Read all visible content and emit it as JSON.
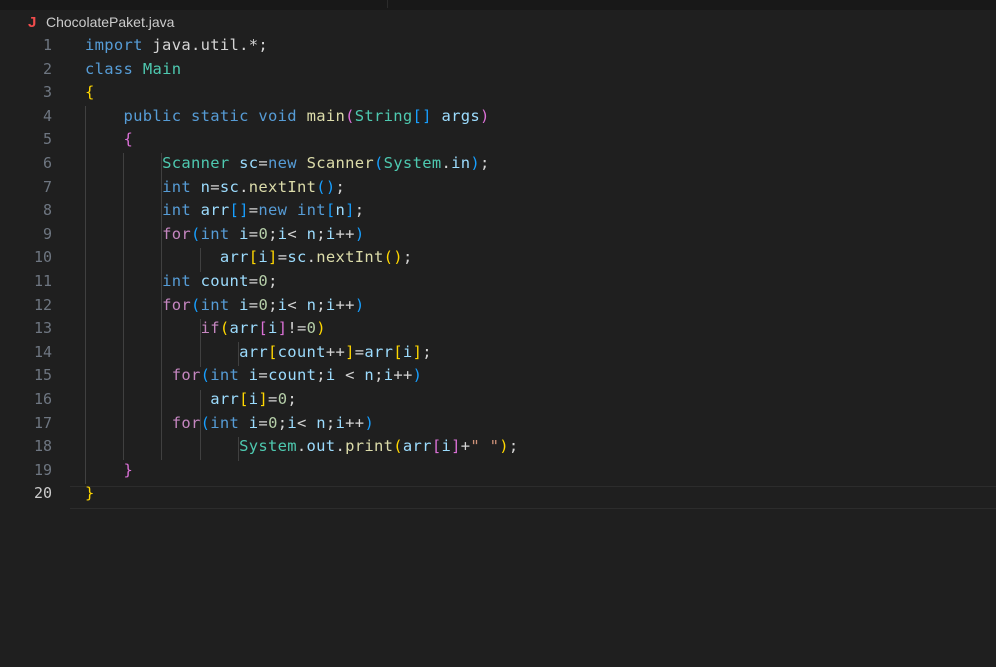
{
  "breadcrumb": {
    "icon": "java-icon",
    "icon_glyph": "J",
    "filename": "ChocolatePaket.java"
  },
  "active_line": 20,
  "code_lines": [
    {
      "n": "1",
      "tokens": [
        [
          "kw",
          "import"
        ],
        [
          "op",
          " java.util.*;"
        ]
      ]
    },
    {
      "n": "2",
      "tokens": [
        [
          "kw",
          "class"
        ],
        [
          "op",
          " "
        ],
        [
          "type",
          "Main"
        ]
      ]
    },
    {
      "n": "3",
      "tokens": [
        [
          "b1",
          "{"
        ]
      ]
    },
    {
      "n": "4",
      "tokens": [
        [
          "op",
          "    "
        ],
        [
          "kw",
          "public"
        ],
        [
          "op",
          " "
        ],
        [
          "kw",
          "static"
        ],
        [
          "op",
          " "
        ],
        [
          "kw",
          "void"
        ],
        [
          "op",
          " "
        ],
        [
          "fn",
          "main"
        ],
        [
          "b2",
          "("
        ],
        [
          "type",
          "String"
        ],
        [
          "b3",
          "[]"
        ],
        [
          "op",
          " "
        ],
        [
          "var",
          "args"
        ],
        [
          "b2",
          ")"
        ]
      ]
    },
    {
      "n": "5",
      "tokens": [
        [
          "op",
          "    "
        ],
        [
          "b2",
          "{"
        ]
      ]
    },
    {
      "n": "6",
      "tokens": [
        [
          "op",
          "        "
        ],
        [
          "type",
          "Scanner"
        ],
        [
          "op",
          " "
        ],
        [
          "var",
          "sc"
        ],
        [
          "op",
          "="
        ],
        [
          "kw",
          "new"
        ],
        [
          "op",
          " "
        ],
        [
          "fn",
          "Scanner"
        ],
        [
          "b3",
          "("
        ],
        [
          "type",
          "System"
        ],
        [
          "op",
          "."
        ],
        [
          "var",
          "in"
        ],
        [
          "b3",
          ")"
        ],
        [
          "op",
          ";"
        ]
      ]
    },
    {
      "n": "7",
      "tokens": [
        [
          "op",
          "        "
        ],
        [
          "kw",
          "int"
        ],
        [
          "op",
          " "
        ],
        [
          "var",
          "n"
        ],
        [
          "op",
          "="
        ],
        [
          "var",
          "sc"
        ],
        [
          "op",
          "."
        ],
        [
          "fn",
          "nextInt"
        ],
        [
          "b3",
          "()"
        ],
        [
          "op",
          ";"
        ]
      ]
    },
    {
      "n": "8",
      "tokens": [
        [
          "op",
          "        "
        ],
        [
          "kw",
          "int"
        ],
        [
          "op",
          " "
        ],
        [
          "var",
          "arr"
        ],
        [
          "b3",
          "[]"
        ],
        [
          "op",
          "="
        ],
        [
          "kw",
          "new"
        ],
        [
          "op",
          " "
        ],
        [
          "kw",
          "int"
        ],
        [
          "b3",
          "["
        ],
        [
          "var",
          "n"
        ],
        [
          "b3",
          "]"
        ],
        [
          "op",
          ";"
        ]
      ]
    },
    {
      "n": "9",
      "tokens": [
        [
          "op",
          "        "
        ],
        [
          "ctl",
          "for"
        ],
        [
          "b3",
          "("
        ],
        [
          "kw",
          "int"
        ],
        [
          "op",
          " "
        ],
        [
          "var",
          "i"
        ],
        [
          "op",
          "="
        ],
        [
          "num",
          "0"
        ],
        [
          "op",
          ";"
        ],
        [
          "var",
          "i"
        ],
        [
          "op",
          "< "
        ],
        [
          "var",
          "n"
        ],
        [
          "op",
          ";"
        ],
        [
          "var",
          "i"
        ],
        [
          "op",
          "++"
        ],
        [
          "b3",
          ")"
        ]
      ]
    },
    {
      "n": "10",
      "tokens": [
        [
          "op",
          "              "
        ],
        [
          "var",
          "arr"
        ],
        [
          "b1",
          "["
        ],
        [
          "var",
          "i"
        ],
        [
          "b1",
          "]"
        ],
        [
          "op",
          "="
        ],
        [
          "var",
          "sc"
        ],
        [
          "op",
          "."
        ],
        [
          "fn",
          "nextInt"
        ],
        [
          "b1",
          "()"
        ],
        [
          "op",
          ";"
        ]
      ]
    },
    {
      "n": "11",
      "tokens": [
        [
          "op",
          "        "
        ],
        [
          "kw",
          "int"
        ],
        [
          "op",
          " "
        ],
        [
          "var",
          "count"
        ],
        [
          "op",
          "="
        ],
        [
          "num",
          "0"
        ],
        [
          "op",
          ";"
        ]
      ]
    },
    {
      "n": "12",
      "tokens": [
        [
          "op",
          "        "
        ],
        [
          "ctl",
          "for"
        ],
        [
          "b3",
          "("
        ],
        [
          "kw",
          "int"
        ],
        [
          "op",
          " "
        ],
        [
          "var",
          "i"
        ],
        [
          "op",
          "="
        ],
        [
          "num",
          "0"
        ],
        [
          "op",
          ";"
        ],
        [
          "var",
          "i"
        ],
        [
          "op",
          "< "
        ],
        [
          "var",
          "n"
        ],
        [
          "op",
          ";"
        ],
        [
          "var",
          "i"
        ],
        [
          "op",
          "++"
        ],
        [
          "b3",
          ")"
        ]
      ]
    },
    {
      "n": "13",
      "tokens": [
        [
          "op",
          "            "
        ],
        [
          "ctl",
          "if"
        ],
        [
          "b1",
          "("
        ],
        [
          "var",
          "arr"
        ],
        [
          "b2",
          "["
        ],
        [
          "var",
          "i"
        ],
        [
          "b2",
          "]"
        ],
        [
          "op",
          "!="
        ],
        [
          "num",
          "0"
        ],
        [
          "b1",
          ")"
        ]
      ]
    },
    {
      "n": "14",
      "tokens": [
        [
          "op",
          "                "
        ],
        [
          "var",
          "arr"
        ],
        [
          "b1",
          "["
        ],
        [
          "var",
          "count"
        ],
        [
          "op",
          "++"
        ],
        [
          "b1",
          "]"
        ],
        [
          "op",
          "="
        ],
        [
          "var",
          "arr"
        ],
        [
          "b1",
          "["
        ],
        [
          "var",
          "i"
        ],
        [
          "b1",
          "]"
        ],
        [
          "op",
          ";"
        ]
      ]
    },
    {
      "n": "15",
      "tokens": [
        [
          "op",
          "         "
        ],
        [
          "ctl",
          "for"
        ],
        [
          "b3",
          "("
        ],
        [
          "kw",
          "int"
        ],
        [
          "op",
          " "
        ],
        [
          "var",
          "i"
        ],
        [
          "op",
          "="
        ],
        [
          "var",
          "count"
        ],
        [
          "op",
          ";"
        ],
        [
          "var",
          "i"
        ],
        [
          "op",
          " < "
        ],
        [
          "var",
          "n"
        ],
        [
          "op",
          ";"
        ],
        [
          "var",
          "i"
        ],
        [
          "op",
          "++"
        ],
        [
          "b3",
          ")"
        ]
      ]
    },
    {
      "n": "16",
      "tokens": [
        [
          "op",
          "             "
        ],
        [
          "var",
          "arr"
        ],
        [
          "b1",
          "["
        ],
        [
          "var",
          "i"
        ],
        [
          "b1",
          "]"
        ],
        [
          "op",
          "="
        ],
        [
          "num",
          "0"
        ],
        [
          "op",
          ";"
        ]
      ]
    },
    {
      "n": "17",
      "tokens": [
        [
          "op",
          "         "
        ],
        [
          "ctl",
          "for"
        ],
        [
          "b3",
          "("
        ],
        [
          "kw",
          "int"
        ],
        [
          "op",
          " "
        ],
        [
          "var",
          "i"
        ],
        [
          "op",
          "="
        ],
        [
          "num",
          "0"
        ],
        [
          "op",
          ";"
        ],
        [
          "var",
          "i"
        ],
        [
          "op",
          "< "
        ],
        [
          "var",
          "n"
        ],
        [
          "op",
          ";"
        ],
        [
          "var",
          "i"
        ],
        [
          "op",
          "++"
        ],
        [
          "b3",
          ")"
        ]
      ]
    },
    {
      "n": "18",
      "tokens": [
        [
          "op",
          "                "
        ],
        [
          "type",
          "System"
        ],
        [
          "op",
          "."
        ],
        [
          "var",
          "out"
        ],
        [
          "op",
          "."
        ],
        [
          "fn",
          "print"
        ],
        [
          "b1",
          "("
        ],
        [
          "var",
          "arr"
        ],
        [
          "b2",
          "["
        ],
        [
          "var",
          "i"
        ],
        [
          "b2",
          "]"
        ],
        [
          "op",
          "+"
        ],
        [
          "str",
          "\" \""
        ],
        [
          "b1",
          ")"
        ],
        [
          "op",
          ";"
        ]
      ]
    },
    {
      "n": "19",
      "tokens": [
        [
          "op",
          "    "
        ],
        [
          "b2",
          "}"
        ]
      ]
    },
    {
      "n": "20",
      "tokens": [
        [
          "b1",
          "}"
        ]
      ]
    }
  ]
}
